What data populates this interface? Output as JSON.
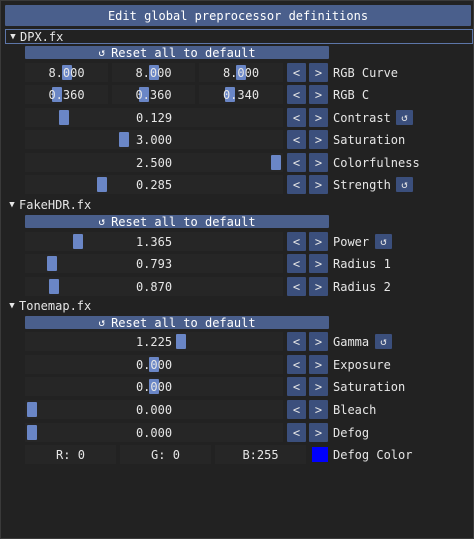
{
  "title_button": "Edit global preprocessor definitions",
  "reset_label": "Reset all to default",
  "icons": {
    "reset": "undo-icon",
    "tree_open": "triangle-down-icon",
    "tree_closed": "triangle-right-icon"
  },
  "colors": {
    "accent": "#4a5f8c",
    "grab": "#6a86c6",
    "defog_color": "#0000ff"
  },
  "sections": {
    "dpx": {
      "name": "DPX.fx",
      "rgb_curve": {
        "label": "RGB Curve",
        "values": [
          "8.000",
          "8.000",
          "8.000"
        ],
        "levels": [
          0.5,
          0.5,
          0.5
        ]
      },
      "rgb_c": {
        "label": "RGB C",
        "values": [
          "0.360",
          "0.360",
          "0.340"
        ],
        "levels": [
          0.36,
          0.36,
          0.34
        ]
      },
      "contrast": {
        "label": "Contrast",
        "value": "0.129",
        "level": 0.13
      },
      "saturation": {
        "label": "Saturation",
        "value": "3.000",
        "level": 0.375
      },
      "colorfulness": {
        "label": "Colorfulness",
        "value": "2.500",
        "level": 1.0
      },
      "strength": {
        "label": "Strength",
        "value": "0.285",
        "level": 0.285
      }
    },
    "fakehdr": {
      "name": "FakeHDR.fx",
      "power": {
        "label": "Power",
        "value": "1.365",
        "level": 0.19
      },
      "radius1": {
        "label": "Radius 1",
        "value": "0.793",
        "level": 0.08
      },
      "radius2": {
        "label": "Radius 2",
        "value": "0.870",
        "level": 0.09
      }
    },
    "tonemap": {
      "name": "Tonemap.fx",
      "gamma": {
        "label": "Gamma",
        "value": "1.225",
        "level": 0.61
      },
      "exposure": {
        "label": "Exposure",
        "value": "0.000",
        "level": 0.5
      },
      "saturation": {
        "label": "Saturation",
        "value": "0.000",
        "level": 0.5
      },
      "bleach": {
        "label": "Bleach",
        "value": "0.000",
        "level": 0.0
      },
      "defog": {
        "label": "Defog",
        "value": "0.000",
        "level": 0.0
      },
      "defog_color": {
        "label": "Defog Color",
        "r": "R:  0",
        "g": "G:  0",
        "b": "B:255"
      }
    }
  },
  "nav": {
    "prev": "<",
    "next": ">"
  }
}
